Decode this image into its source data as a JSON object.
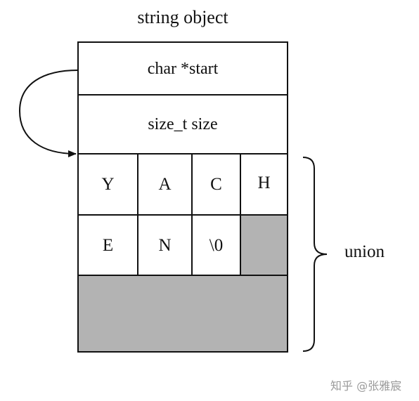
{
  "title": "string object",
  "fields": {
    "start": "char *start",
    "size": "size_t size"
  },
  "buffer": {
    "row1": [
      "Y",
      "A",
      "C",
      "H"
    ],
    "row2": [
      "E",
      "N",
      "\\0"
    ]
  },
  "union_label": "union",
  "watermark": "知乎 @张雅宸",
  "colors": {
    "stroke": "#111111",
    "unused_fill": "#b3b3b3",
    "watermark": "#9a9a9a"
  }
}
